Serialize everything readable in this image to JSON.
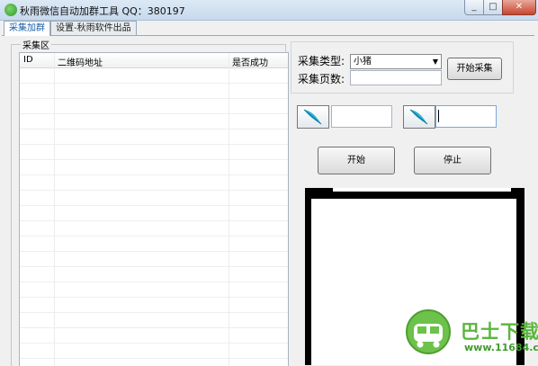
{
  "window": {
    "title": "秋雨微信自动加群工具  QQ：380197",
    "icon": "wechat-app-icon",
    "controls": [
      "minimize",
      "maximize",
      "close"
    ]
  },
  "tabs": [
    {
      "label": "采集加群",
      "active": true
    },
    {
      "label": "设置-秋雨软件出品",
      "active": false
    }
  ],
  "collect_area": {
    "title": "采集区",
    "columns": [
      "ID",
      "二维码地址",
      "是否成功"
    ],
    "rows": []
  },
  "collect_controls": {
    "type_label": "采集类型:",
    "type_value": "小猪",
    "pages_label": "采集页数:",
    "pages_value": "",
    "collect_button": "开始采集"
  },
  "inputs": {
    "field_one_value": "",
    "field_two_value": "",
    "icon": "feather-pen-icon"
  },
  "actions": {
    "start_label": "开始",
    "stop_label": "停止"
  },
  "watermark": {
    "name": "巴士下载",
    "url": "www.11684.com"
  },
  "colors": {
    "accent_tab_text": "#1a5fa8",
    "watermark_green": "#59b73c"
  }
}
